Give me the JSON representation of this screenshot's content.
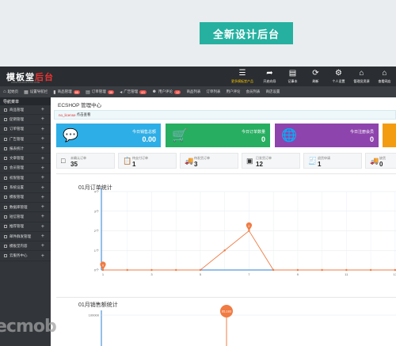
{
  "banner": "全新设计后台",
  "app": {
    "logo_main": "模板堂",
    "logo_red": "后台",
    "logo_sub": "WWW.MOBANTANG.COM",
    "top_actions": [
      {
        "icon": "menu-icon",
        "glyph": "☰",
        "label": "更多模板堂产品"
      },
      {
        "icon": "share-icon",
        "glyph": "➦",
        "label": "开启向导"
      },
      {
        "icon": "notepad-icon",
        "glyph": "▤",
        "label": "记事本"
      },
      {
        "icon": "refresh-icon",
        "glyph": "⟳",
        "label": "刷新"
      },
      {
        "icon": "gear-icon",
        "glyph": "⚙",
        "label": "个人设置"
      },
      {
        "icon": "home-icon",
        "glyph": "⌂",
        "label": "管理员资源"
      },
      {
        "icon": "home2-icon",
        "glyph": "⌂",
        "label": "查看网店"
      }
    ]
  },
  "navbar": [
    {
      "icon": "home-icon",
      "label": "起始页"
    },
    {
      "icon": "grid-icon",
      "label": "设置导航栏"
    },
    {
      "icon": "box-icon",
      "label": "商品管理",
      "badge": "85"
    },
    {
      "icon": "order-icon",
      "label": "订单管理",
      "badge": "35"
    },
    {
      "icon": "ad-icon",
      "label": "广告管理",
      "badge": "43"
    },
    {
      "icon": "user-icon",
      "label": "用户评论",
      "badge": "12"
    },
    {
      "icon": "",
      "label": "商品列表"
    },
    {
      "icon": "",
      "label": "订单列表"
    },
    {
      "icon": "",
      "label": "用户评论"
    },
    {
      "icon": "",
      "label": "会员列表"
    },
    {
      "icon": "",
      "label": "商店设置"
    }
  ],
  "sidebar": {
    "title": "导航菜单",
    "items": [
      "商品管理",
      "促销管理",
      "订单管理",
      "广告管理",
      "报表统计",
      "文章管理",
      "会员管理",
      "权限管理",
      "系统设置",
      "模板管理",
      "数据库管理",
      "短信管理",
      "推荐管理",
      "邮件群发管理",
      "模板堂内容",
      "云服务中心"
    ]
  },
  "main": {
    "title": "ECSHOP 管理中心",
    "license_link": "no_license",
    "license_text": "点击查看",
    "cards": [
      {
        "label": "今日销售总额",
        "value": "0.00",
        "icon": "chat-icon",
        "glyph": "💬"
      },
      {
        "label": "今日订单数量",
        "value": "0",
        "icon": "cart-icon",
        "glyph": "🛒"
      },
      {
        "label": "今日注册会员",
        "value": "0",
        "icon": "globe-icon",
        "glyph": "🌐"
      }
    ],
    "stats": [
      {
        "label": "未确认订单",
        "value": "35",
        "icon": "square-icon",
        "glyph": "□"
      },
      {
        "label": "待支付订单",
        "value": "1",
        "icon": "clipboard-icon",
        "glyph": "📋"
      },
      {
        "label": "待发货订单",
        "value": "3",
        "icon": "truck-icon",
        "glyph": "🚚"
      },
      {
        "label": "已发货订单",
        "value": "12",
        "icon": "doc-icon",
        "glyph": "▣"
      },
      {
        "label": "退货申请",
        "value": "1",
        "icon": "receipt-icon",
        "glyph": "🧾"
      },
      {
        "label": "缺货",
        "value": "0",
        "icon": "truck2-icon",
        "glyph": "🚚"
      }
    ]
  },
  "chart_data": [
    {
      "type": "line",
      "title": "01月订单统计",
      "x": [
        1,
        2,
        3,
        4,
        5,
        6,
        7,
        8,
        9,
        10,
        11,
        12,
        13
      ],
      "x_tick_labels": [
        "1",
        "3",
        "5",
        "7",
        "9",
        "11",
        "13"
      ],
      "values": [
        0,
        0,
        0,
        0,
        0,
        1,
        2,
        0,
        0,
        0,
        0,
        0,
        0
      ],
      "ylim": [
        0,
        4
      ],
      "y_ticks": [
        "0",
        "1",
        "2",
        "3",
        "4"
      ],
      "color": "#f07b43",
      "grid": true,
      "pin_labels": [
        "0",
        "2"
      ]
    },
    {
      "type": "line",
      "title": "01月销售额统计",
      "y_ticks": [
        "100000"
      ],
      "color": "#f07b43",
      "pin_label": "65,183"
    }
  ],
  "watermark": "ecmob"
}
